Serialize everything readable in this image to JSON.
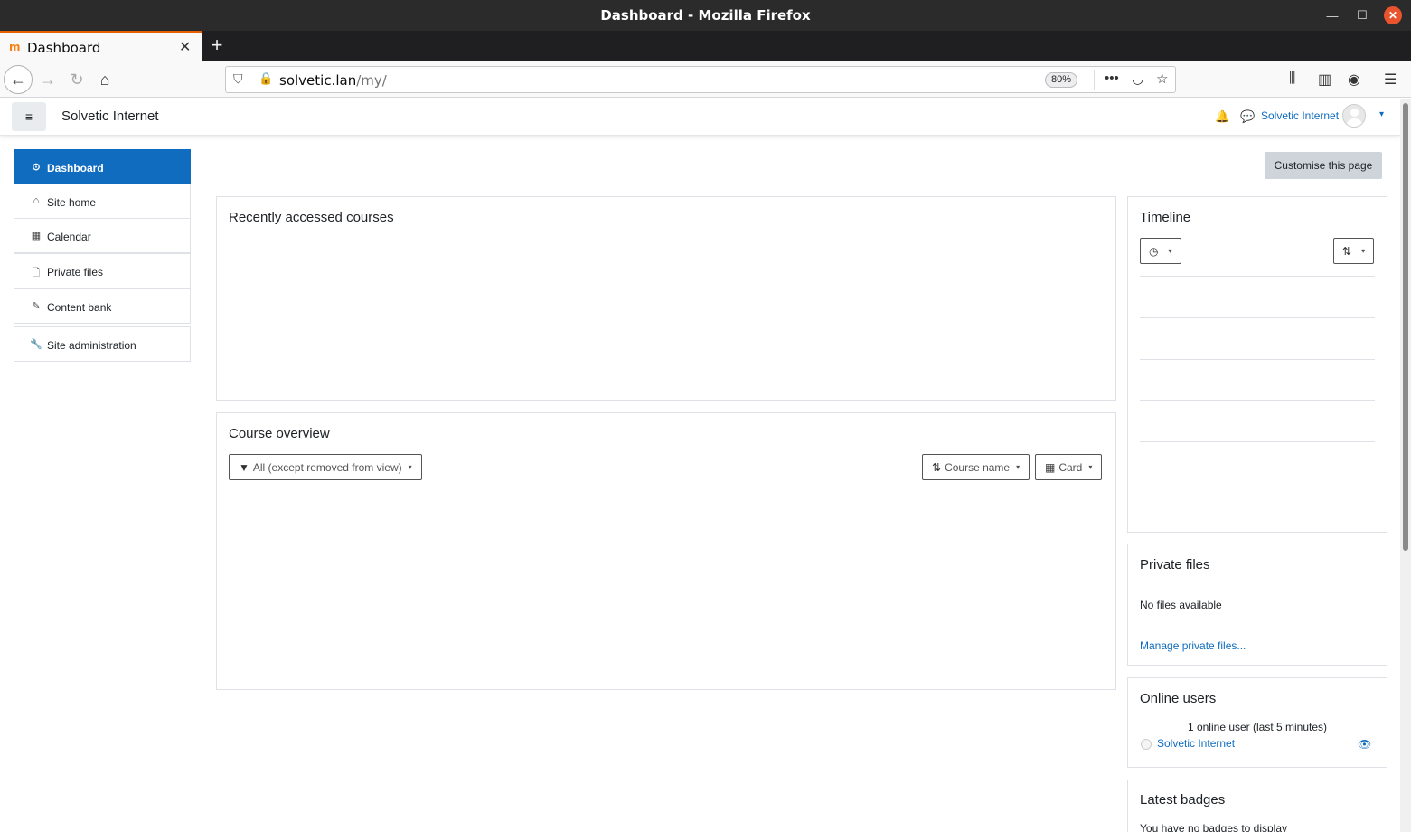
{
  "window": {
    "title": "Dashboard - Mozilla Firefox",
    "minimize_glyph": "—",
    "maximize_glyph": "☐",
    "close_glyph": "✕"
  },
  "browser": {
    "tab_title": "Dashboard",
    "favicon_text": "m",
    "tab_close_glyph": "✕",
    "new_tab_glyph": "+",
    "url_host": "solvetic.lan",
    "url_path": "/my/",
    "zoom": "80%",
    "icons": {
      "back": "←",
      "forward": "→",
      "reload": "↻",
      "home": "⌂",
      "shield": "⛉",
      "insecure_lock": "🔒",
      "page_actions": "•••",
      "pocket": "◡",
      "bookmark_star": "☆",
      "library": "⫼",
      "sidebar": "▥",
      "account": "◉",
      "menu": "☰"
    }
  },
  "moodle": {
    "site_name": "Solvetic Internet",
    "user_name": "Solvetic Internet",
    "menu_glyph": "≡",
    "bell_glyph": "🔔",
    "chat_glyph": "💬",
    "caret_glyph": "▾"
  },
  "nav_drawer": [
    {
      "label": "Dashboard",
      "icon": "⊙"
    },
    {
      "label": "Site home",
      "icon": "⌂"
    },
    {
      "label": "Calendar",
      "icon": "▦"
    },
    {
      "label": "Private files",
      "icon": "🗋"
    },
    {
      "label": "Content bank",
      "icon": "✎"
    },
    {
      "label": "Site administration",
      "icon": "🔧"
    }
  ],
  "main": {
    "customise_button": "Customise this page",
    "recent_courses_title": "Recently accessed courses",
    "course_overview": {
      "title": "Course overview",
      "filter_label": "All (except removed from view)",
      "filter_icon": "▼",
      "sort_label": "Course name",
      "sort_icon": "⇅",
      "view_label": "Card",
      "view_icon": "▦",
      "caret": "▾"
    }
  },
  "right_blocks": {
    "timeline": {
      "title": "Timeline",
      "filter_icon": "◷",
      "sort_icon": "⇅",
      "caret": "▾"
    },
    "private_files": {
      "title": "Private files",
      "empty_text": "No files available",
      "manage_link": "Manage private files..."
    },
    "online_users": {
      "title": "Online users",
      "summary": "1 online user (last 5 minutes)",
      "user": "Solvetic Internet",
      "eye_icon": "👁"
    },
    "latest_badges": {
      "title": "Latest badges",
      "empty_text": "You have no badges to display"
    }
  }
}
